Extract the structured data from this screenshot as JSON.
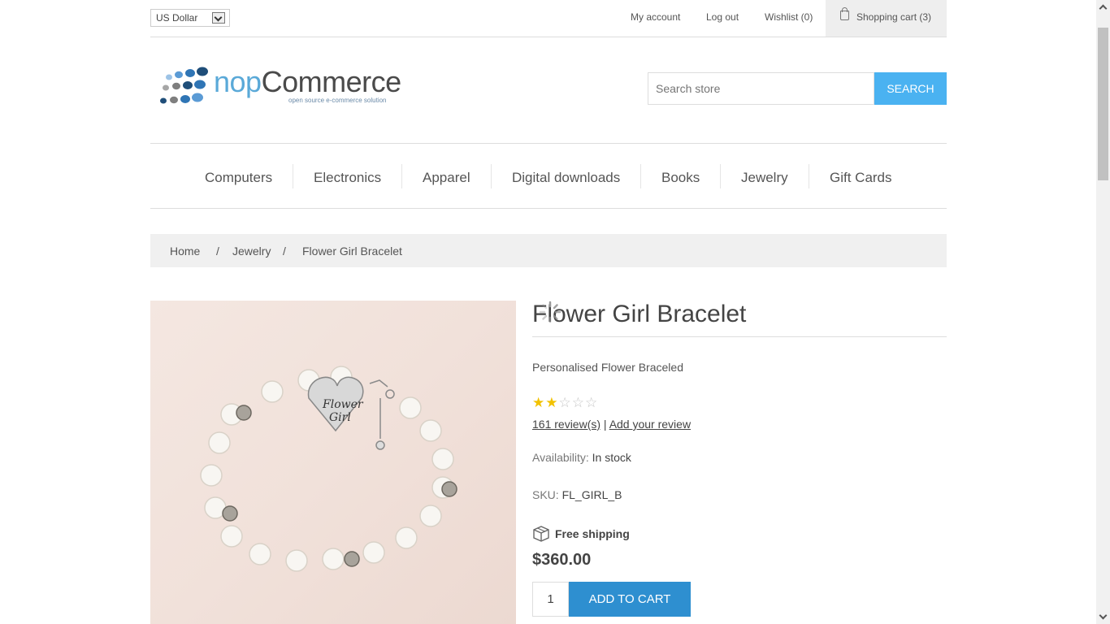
{
  "header": {
    "currency": "US Dollar",
    "links": {
      "my_account": "My account",
      "log_out": "Log out",
      "wishlist": "Wishlist (0)",
      "shopping_cart": "Shopping cart (3)"
    }
  },
  "logo": {
    "name_part1": "nop",
    "name_part2": "Commerce",
    "tagline": "open source e-commerce solution"
  },
  "search": {
    "placeholder": "Search store",
    "button_label": "Search"
  },
  "menu": {
    "items": [
      "Computers",
      "Electronics",
      "Apparel",
      "Digital downloads",
      "Books",
      "Jewelry",
      "Gift Cards"
    ]
  },
  "breadcrumb": {
    "items": [
      "Home",
      "Jewelry",
      "Flower Girl Bracelet"
    ],
    "separator": "/"
  },
  "product": {
    "image_text_line1": "Flower",
    "image_text_line2": "Girl",
    "title": "Flower Girl Bracelet",
    "short_description": "Personalised Flower Braceled",
    "rating": 2,
    "rating_max": 5,
    "reviews_link": "161 review(s)",
    "reviews_separator": "|",
    "add_review_link": "Add your review",
    "availability_label": "Availability:",
    "availability_value": "In stock",
    "sku_label": "SKU:",
    "sku_value": "FL_GIRL_B",
    "shipping": "Free shipping",
    "price": "$360.00",
    "quantity": "1",
    "add_to_cart_label": "Add to cart"
  },
  "colors": {
    "accent": "#4ab2f1",
    "add_to_cart": "#2e8fd0",
    "star_filled": "#f2c200"
  }
}
